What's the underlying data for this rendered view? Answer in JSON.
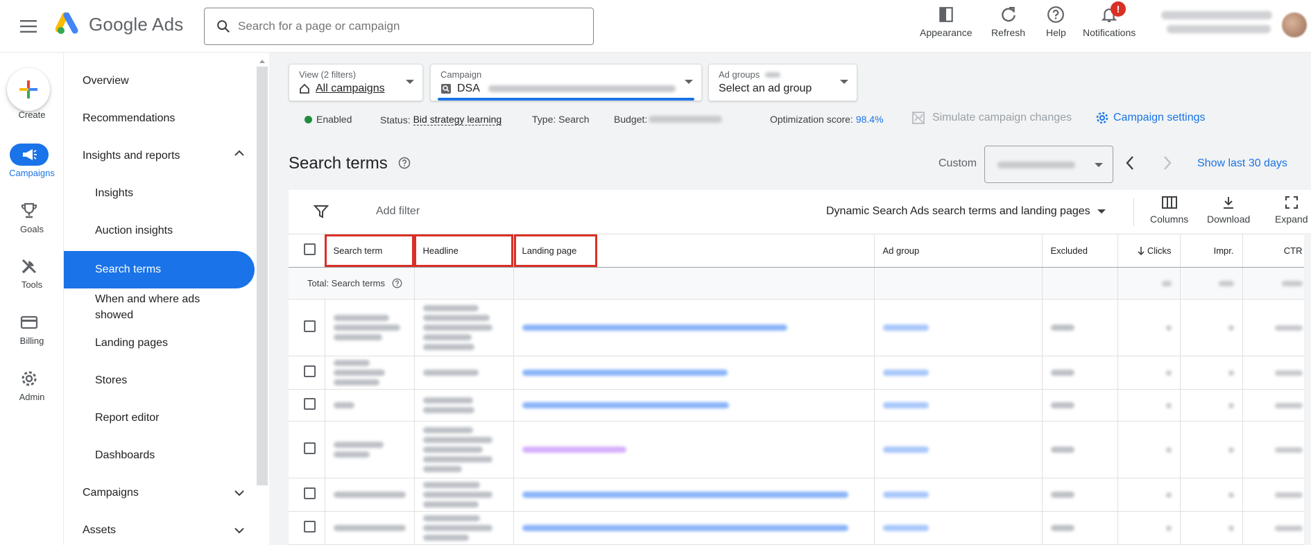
{
  "app": {
    "brand": "Google Ads"
  },
  "search": {
    "placeholder": "Search for a page or campaign"
  },
  "top_actions": [
    {
      "label": "Appearance",
      "icon": "appearance-icon"
    },
    {
      "label": "Refresh",
      "icon": "refresh-icon"
    },
    {
      "label": "Help",
      "icon": "help-icon"
    },
    {
      "label": "Notifications",
      "icon": "notifications-icon",
      "badge": "!"
    }
  ],
  "rail": {
    "create": "Create",
    "campaigns": "Campaigns",
    "goals": "Goals",
    "tools": "Tools",
    "billing": "Billing",
    "admin": "Admin"
  },
  "sidenav": {
    "items": [
      {
        "label": "Overview"
      },
      {
        "label": "Recommendations"
      },
      {
        "label": "Insights and reports"
      },
      {
        "label": "Insights"
      },
      {
        "label": "Auction insights"
      },
      {
        "label": "Search terms"
      },
      {
        "label": "When and where ads showed"
      },
      {
        "label": "Landing pages"
      },
      {
        "label": "Stores"
      },
      {
        "label": "Report editor"
      },
      {
        "label": "Dashboards"
      },
      {
        "label": "Campaigns"
      },
      {
        "label": "Assets"
      }
    ]
  },
  "filters": {
    "view_label": "View (2 filters)",
    "view_value": "All campaigns",
    "campaign_label": "Campaign",
    "campaign_value": "DSA",
    "adgroups_label": "Ad groups",
    "adgroups_value": "Select an ad group"
  },
  "status": {
    "enabled": "Enabled",
    "status_label": "Status:",
    "status_value": "Bid strategy learning",
    "type": "Type: Search",
    "budget_label": "Budget:",
    "opt_label": "Optimization score:",
    "opt_value": "98.4%",
    "simulate": "Simulate campaign changes",
    "settings": "Campaign settings"
  },
  "page": {
    "title": "Search terms",
    "custom": "Custom",
    "show_last": "Show last 30 days"
  },
  "toolbar": {
    "add_filter": "Add filter",
    "view_select": "Dynamic Search Ads search terms and landing pages",
    "columns": "Columns",
    "download": "Download",
    "expand": "Expand"
  },
  "table": {
    "headers": {
      "search_term": "Search term",
      "headline": "Headline",
      "landing_page": "Landing page",
      "ad_group": "Ad group",
      "excluded": "Excluded",
      "clicks": "Clicks",
      "impr": "Impr.",
      "ctr": "CTR"
    },
    "total_label": "Total: Search terms"
  },
  "colors": {
    "accent": "#1a73e8",
    "highlight": "#d93025",
    "enabled_dot": "#1e8e3e"
  }
}
